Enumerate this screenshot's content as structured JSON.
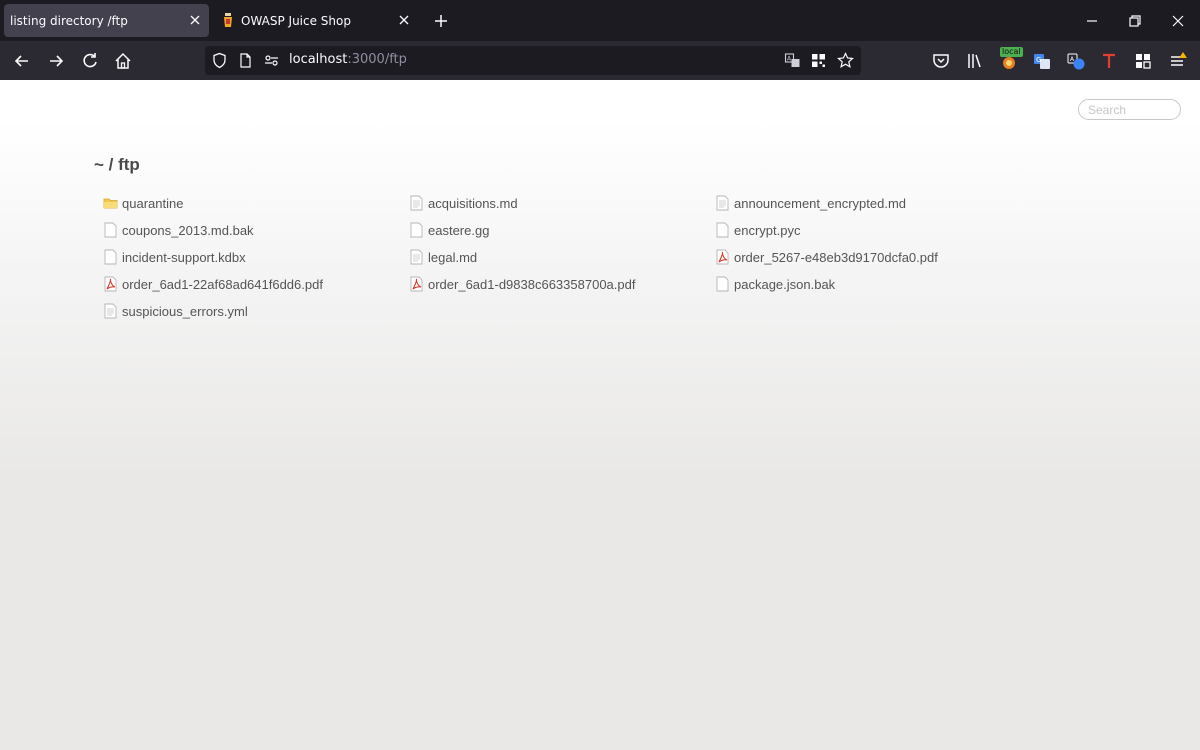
{
  "tabs": [
    {
      "title": "listing directory /ftp",
      "active": true
    },
    {
      "title": "OWASP Juice Shop",
      "active": false
    }
  ],
  "urlbar": {
    "host": "localhost",
    "path": ":3000/ftp"
  },
  "toolbar": {
    "badge": "local"
  },
  "page": {
    "search_placeholder": "Search",
    "breadcrumb": "~ / ftp",
    "files": [
      {
        "name": "quarantine",
        "icon": "folder-icon"
      },
      {
        "name": "acquisitions.md",
        "icon": "text-file-icon"
      },
      {
        "name": "announcement_encrypted.md",
        "icon": "text-file-icon"
      },
      {
        "name": "coupons_2013.md.bak",
        "icon": "blank-file-icon"
      },
      {
        "name": "eastere.gg",
        "icon": "blank-file-icon"
      },
      {
        "name": "encrypt.pyc",
        "icon": "blank-file-icon"
      },
      {
        "name": "incident-support.kdbx",
        "icon": "blank-file-icon"
      },
      {
        "name": "legal.md",
        "icon": "text-file-icon"
      },
      {
        "name": "order_5267-e48eb3d9170dcfa0.pdf",
        "icon": "pdf-file-icon"
      },
      {
        "name": "order_6ad1-22af68ad641f6dd6.pdf",
        "icon": "pdf-file-icon"
      },
      {
        "name": "order_6ad1-d9838c663358700a.pdf",
        "icon": "pdf-file-icon"
      },
      {
        "name": "package.json.bak",
        "icon": "blank-file-icon"
      },
      {
        "name": "suspicious_errors.yml",
        "icon": "text-file-icon"
      }
    ]
  },
  "colors": {
    "tab_bar": "#1c1b22",
    "nav_bar": "#2b2a33",
    "active_tab": "#42414d",
    "pdf_red": "#d8392b",
    "folder_yellow": "#f2c94c"
  }
}
